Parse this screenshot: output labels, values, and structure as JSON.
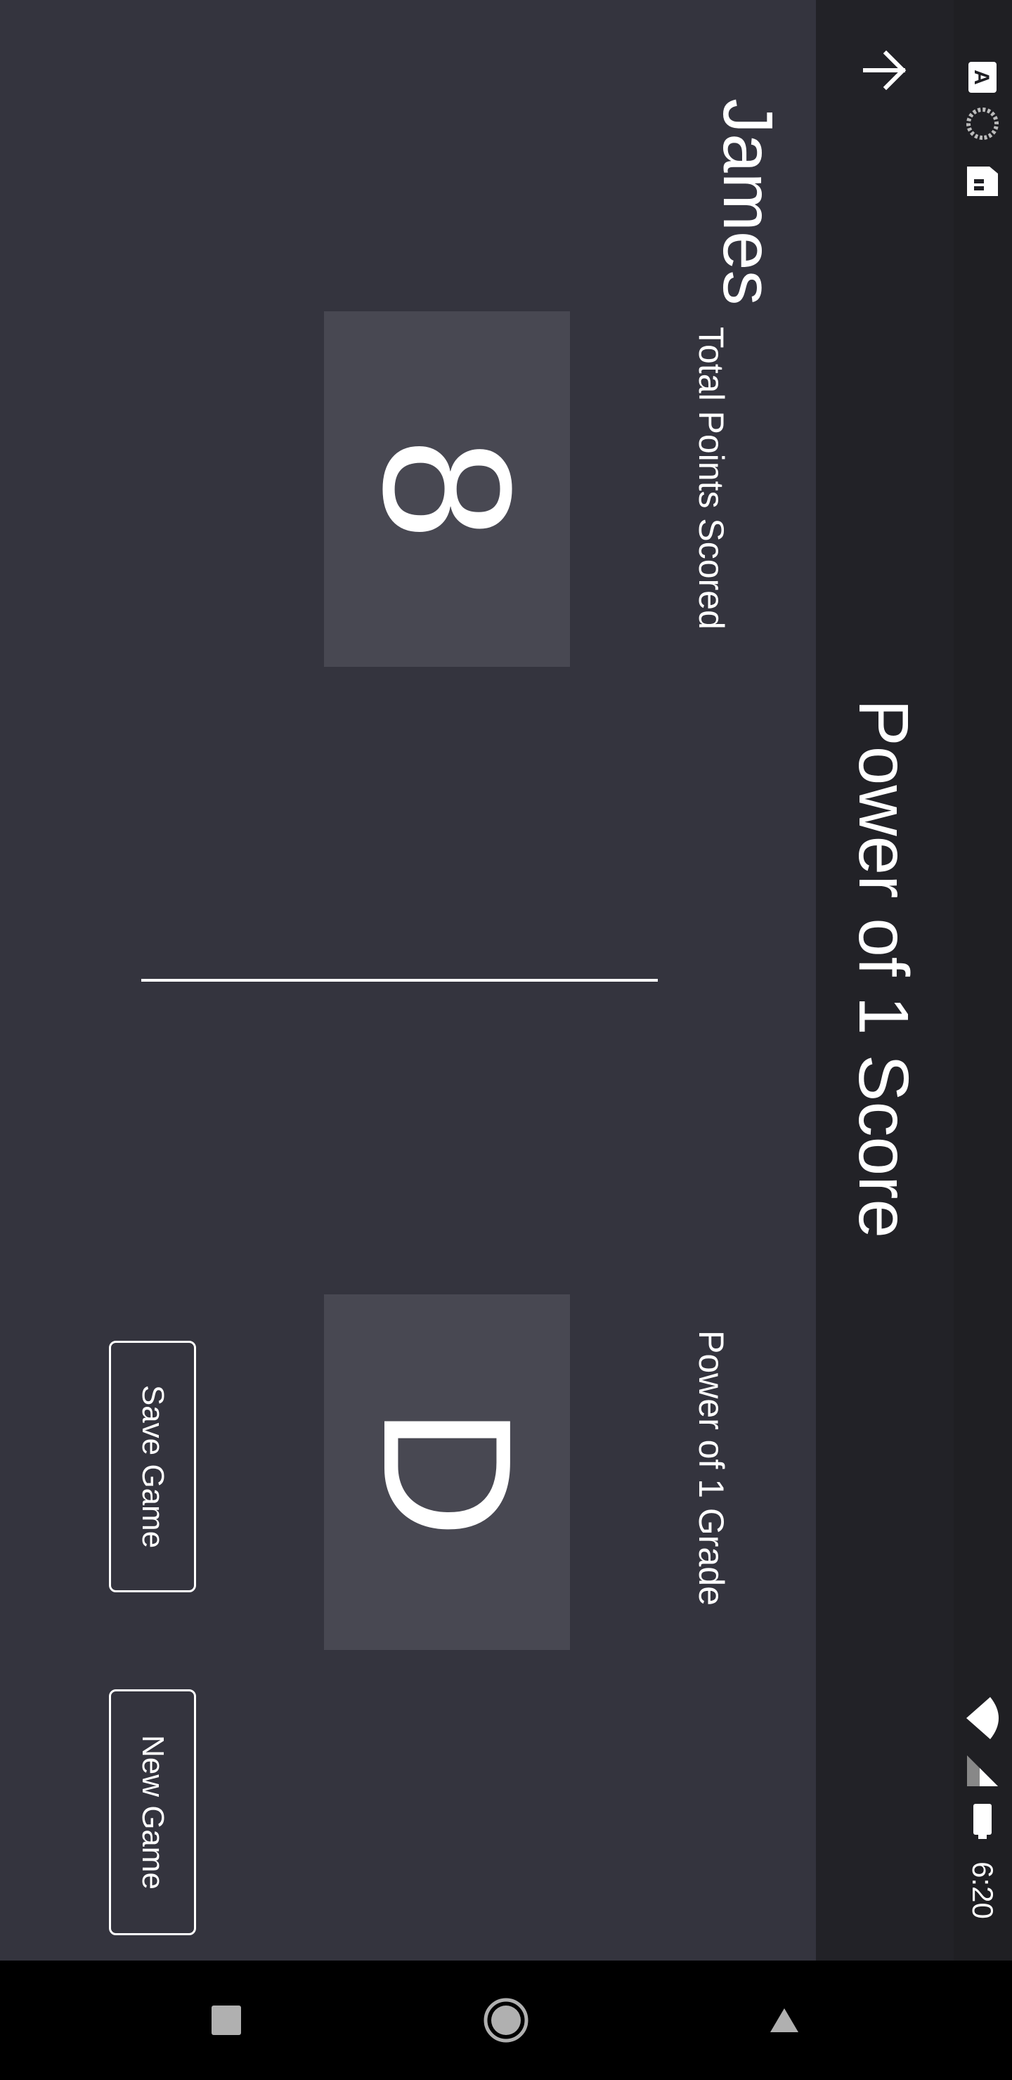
{
  "status_bar": {
    "time": "6:20",
    "icons": [
      "keyboard-a-icon",
      "sync-icon",
      "sd-card-icon",
      "wifi-icon",
      "signal-icon",
      "battery-icon"
    ]
  },
  "app_bar": {
    "title": "Power of 1 Score",
    "back_icon": "arrow-back-icon"
  },
  "player": {
    "name": "James"
  },
  "stats": {
    "total_points": {
      "value": "8",
      "label": "Total Points Scored"
    },
    "grade": {
      "value": "D",
      "label": "Power of 1 Grade"
    }
  },
  "buttons": {
    "save": "Save Game",
    "new": "New Game"
  },
  "nav": {
    "icons": [
      "back-triangle-icon",
      "home-circle-icon",
      "recents-square-icon"
    ]
  },
  "colors": {
    "background": "#34343e",
    "app_bar": "#222227",
    "status_bar": "#1f1f23",
    "score_box": "#484852",
    "text": "#ffffff"
  }
}
